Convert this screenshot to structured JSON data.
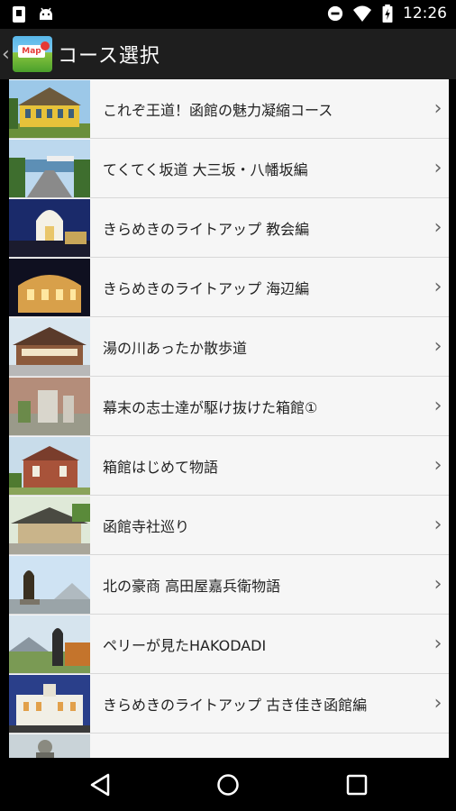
{
  "status_bar": {
    "time": "12:26"
  },
  "app_bar": {
    "title": "コース選択",
    "logo_text": "Map"
  },
  "courses": [
    {
      "label": "これぞ王道！函館の魅力凝縮コース",
      "thumb": "yellow-building"
    },
    {
      "label": "てくてく坂道 大三坂・八幡坂編",
      "thumb": "slope-harbor"
    },
    {
      "label": "きらめきのライトアップ 教会編",
      "thumb": "church-night"
    },
    {
      "label": "きらめきのライトアップ 海辺編",
      "thumb": "warehouse-night"
    },
    {
      "label": "湯の川あったか散歩道",
      "thumb": "onsen-building"
    },
    {
      "label": "幕末の志士達が駆け抜けた箱館①",
      "thumb": "stone-monument"
    },
    {
      "label": "箱館はじめて物語",
      "thumb": "brick-house"
    },
    {
      "label": "函館寺社巡り",
      "thumb": "temple"
    },
    {
      "label": "北の豪商 高田屋嘉兵衛物語",
      "thumb": "statue-sky"
    },
    {
      "label": "ペリーが見たHAKODADI",
      "thumb": "perry-statue"
    },
    {
      "label": "きらめきのライトアップ 古き佳き函館編",
      "thumb": "old-building-night"
    },
    {
      "label": "",
      "thumb": "partial-row"
    }
  ],
  "colors": {
    "app_bar": "#1e1e1e",
    "list_bg": "#f6f6f6",
    "divider": "#d8d8d8"
  }
}
